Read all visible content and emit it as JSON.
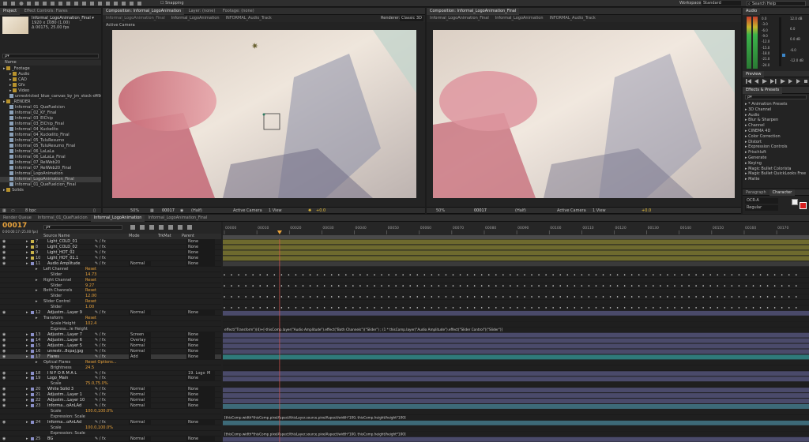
{
  "top": {
    "workspace_label": "Workspace:",
    "workspace_value": "Standard",
    "search_placeholder": "Search Help",
    "snapping": "Snapping"
  },
  "project": {
    "tab": "Project",
    "effect_controls_tab": "Effect Controls: Flares",
    "comp_name": "Informal_LogoAnimation_Final ▾",
    "comp_info1": "1920 x 1080 (1.00)",
    "comp_info2": "Δ 00175, 25.00 fps",
    "search_placeholder": "ρ▾",
    "name_header": "Name",
    "bpc": "8 bpc",
    "items": [
      {
        "label": "_Footage",
        "kind": "folder",
        "indent": 0
      },
      {
        "label": "Audio",
        "kind": "folder",
        "indent": 1
      },
      {
        "label": "CAD",
        "kind": "folder",
        "indent": 1
      },
      {
        "label": "Gfx",
        "kind": "folder",
        "indent": 1
      },
      {
        "label": "Video",
        "kind": "folder",
        "indent": 1
      },
      {
        "label": "unrestricted_blue_canvas_by_jm_stock-d49eg",
        "kind": "file",
        "indent": 1
      },
      {
        "label": "_RENDER",
        "kind": "folder",
        "indent": 0
      },
      {
        "label": "Informal_01_QueFuelcion",
        "kind": "file",
        "indent": 1
      },
      {
        "label": "Informal_02_KY_Final",
        "kind": "file",
        "indent": 1
      },
      {
        "label": "Informal_03_ElChip",
        "kind": "file",
        "indent": 1
      },
      {
        "label": "Informal_03_ElChip_Final",
        "kind": "file",
        "indent": 1
      },
      {
        "label": "Informal_04_Kuckelito",
        "kind": "file",
        "indent": 1
      },
      {
        "label": "Informal_04_Kuckelito_Final",
        "kind": "file",
        "indent": 1
      },
      {
        "label": "Informal_05_TuluResumo",
        "kind": "file",
        "indent": 1
      },
      {
        "label": "Informal_05_TuluResumo_Final",
        "kind": "file",
        "indent": 1
      },
      {
        "label": "Informal_06_LaLaLa",
        "kind": "file",
        "indent": 1
      },
      {
        "label": "Informal_06_LaLaLa_Final",
        "kind": "file",
        "indent": 1
      },
      {
        "label": "Informal_07_RelWeb20",
        "kind": "file",
        "indent": 1
      },
      {
        "label": "Informal_07_RelWeb20_Final",
        "kind": "file",
        "indent": 1
      },
      {
        "label": "Informal_LogoAnimation",
        "kind": "file",
        "indent": 1
      },
      {
        "label": "Informal_LogoAnimation_Final",
        "kind": "file",
        "indent": 1,
        "selected": true
      },
      {
        "label": "Informal_01_QueFuelcion_Final",
        "kind": "file",
        "indent": 1
      },
      {
        "label": "Solids",
        "kind": "folder",
        "indent": 0
      }
    ]
  },
  "comp1": {
    "tab": "Composition: Informal_LogoAnimation",
    "layer_tab": "Layer: (none)",
    "footage_tab": "Footage: (none)",
    "crumbs": [
      "Informal_LogoAnimation_Final",
      "Informal_LogoAnimation",
      "INFORMAL_Audio_Track"
    ],
    "renderer": "Renderer:",
    "renderer_value": "Classic 3D",
    "active_camera": "Active Camera",
    "zoom": "50%",
    "timecode": "00017",
    "res": "(Half)",
    "view": "Active Camera",
    "views": "1 View",
    "offset": "+0.0"
  },
  "comp2": {
    "tab": "Composition: Informal_LogoAnimation_Final",
    "crumbs": [
      "Informal_LogoAnimation_Final",
      "Informal_LogoAnimation",
      "INFORMAL_Audio_Track"
    ],
    "zoom": "50%",
    "timecode": "00017",
    "res": "(Half)",
    "view": "Active Camera",
    "views": "1 View",
    "offset": "+0.0"
  },
  "audio": {
    "tab": "Audio",
    "db_left": [
      "0.0",
      "-3.0",
      "-6.0",
      "-9.0",
      "-12.0",
      "-15.0",
      "-18.0",
      "-21.0",
      "-24.0"
    ],
    "db_right": [
      "12.0 dB",
      "6.0",
      "0.0 dB",
      "-6.0",
      "-12.0 dB"
    ]
  },
  "preview": {
    "tab": "Preview"
  },
  "effects": {
    "tab": "Effects & Presets",
    "search": "ρ▾",
    "items": [
      "* Animation Presets",
      "3D Channel",
      "Audio",
      "Blur & Sharpen",
      "Channel",
      "CINEMA 4D",
      "Color Correction",
      "Distort",
      "Expression Controls",
      "Frischluft",
      "Generate",
      "Keying",
      "Magic Bullet Colorista",
      "Magic Bullet QuickLooks Free",
      "Matte"
    ]
  },
  "character": {
    "tab1": "Paragraph",
    "tab2": "Character",
    "font": "OCR-A",
    "style": "Regular"
  },
  "timeline": {
    "tabs": [
      "Render Queue",
      "Informal_01_QueFuelcion",
      "Informal_LogoAnimation",
      "Informal_LogoAnimation_Final"
    ],
    "timecode": "00017",
    "timecode_sub": "0:00:00:17 (25.00 fps)",
    "search": "ρ▾",
    "cols": {
      "source": "Source Name",
      "mode": "Mode",
      "trkmat": "TrkMat",
      "parent": "Parent"
    },
    "ruler": [
      "00000",
      "00010",
      "00020",
      "00030",
      "00040",
      "00050",
      "00060",
      "00070",
      "00080",
      "00090",
      "00100",
      "00110",
      "00120",
      "00130",
      "00140",
      "00150",
      "00160",
      "00170"
    ],
    "expr1": "effect(\"Transform\")(4)+[-thisComp.layer(\"Audio Amplitude\").effect(\"Both Channels\")(\"Slider\") ; (1 * thisComp.layer(\"Audio Amplitude\").effect(\"Slider Control\")(\"Slider\")]",
    "expr2": "[thisComp.width*thisComp.pixelAspect/thisLayer.source.pixelAspect/width*100, thisComp.height/height*100]",
    "expr3": "[thisComp.width*thisComp.pixelAspect/thisLayer.source.pixelAspect/width*100, thisComp.height/height*100]",
    "rows": [
      {
        "num": "7",
        "name": "Light_COLD_01",
        "mode": "",
        "parent": "None",
        "lv": 0
      },
      {
        "num": "8",
        "name": "Light_COLD_02",
        "mode": "",
        "parent": "None",
        "lv": 0
      },
      {
        "num": "9",
        "name": "Light_HOT_02",
        "mode": "",
        "parent": "None",
        "lv": 0
      },
      {
        "num": "10",
        "name": "Light_HOT_01.1",
        "mode": "",
        "parent": "None",
        "lv": 0
      },
      {
        "num": "11",
        "name": "Audio Amplitude",
        "mode": "Normal",
        "parent": "None",
        "lv": 0
      },
      {
        "num": "",
        "name": "Left Channel",
        "val": "Reset",
        "lv": 1
      },
      {
        "num": "",
        "name": "Slider",
        "val": "14.73",
        "lv": 2
      },
      {
        "num": "",
        "name": "Right Channel",
        "val": "Reset",
        "lv": 1
      },
      {
        "num": "",
        "name": "Slider",
        "val": "9.27",
        "lv": 2
      },
      {
        "num": "",
        "name": "Both Channels",
        "val": "Reset",
        "lv": 1
      },
      {
        "num": "",
        "name": "Slider",
        "val": "12.00",
        "lv": 2
      },
      {
        "num": "",
        "name": "Slider Control",
        "val": "Reset",
        "lv": 1
      },
      {
        "num": "",
        "name": "Slider",
        "val": "1.00",
        "lv": 2
      },
      {
        "num": "12",
        "name": "Adjustm...Layer 9",
        "mode": "Normal",
        "parent": "None",
        "lv": 0
      },
      {
        "num": "",
        "name": "Transform",
        "val": "Reset",
        "lv": 1
      },
      {
        "num": "",
        "name": "Scale Height",
        "val": "102.4",
        "lv": 2
      },
      {
        "num": "",
        "name": "Express...le Height",
        "val": "",
        "lv": 2
      },
      {
        "num": "13",
        "name": "Adjustm...Layer 7",
        "mode": "Screen",
        "parent": "None",
        "lv": 0
      },
      {
        "num": "14",
        "name": "Adjustm...Layer 6",
        "mode": "Overlay",
        "parent": "None",
        "lv": 0
      },
      {
        "num": "15",
        "name": "Adjustm...Layer 5",
        "mode": "Normal",
        "parent": "None",
        "lv": 0
      },
      {
        "num": "16",
        "name": "unrestr...8cpaj.jpg",
        "mode": "Normal",
        "parent": "None",
        "lv": 0
      },
      {
        "num": "17",
        "name": "Flares",
        "mode": "Add",
        "parent": "None",
        "lv": 0,
        "sel": true
      },
      {
        "num": "",
        "name": "Optical Flares",
        "val": "Reset  Options...",
        "lv": 1
      },
      {
        "num": "",
        "name": "Brightness",
        "val": "24.5",
        "lv": 2
      },
      {
        "num": "18",
        "name": "I N F O R M A L",
        "mode": "",
        "parent": "19. Logo_M",
        "lv": 0
      },
      {
        "num": "19",
        "name": "Logo_Main",
        "mode": "",
        "parent": "None",
        "lv": 0
      },
      {
        "num": "",
        "name": "Scale",
        "val": "75.0,75.0%",
        "lv": 2
      },
      {
        "num": "20",
        "name": "White Solid 3",
        "mode": "Normal",
        "parent": "None",
        "lv": 0
      },
      {
        "num": "21",
        "name": "Adjustm...Layer 1",
        "mode": "Normal",
        "parent": "None",
        "lv": 0
      },
      {
        "num": "22",
        "name": "Adjustm...Layer 10",
        "mode": "Normal",
        "parent": "None",
        "lv": 0
      },
      {
        "num": "23",
        "name": "Informa...oAnLAd",
        "mode": "Normal",
        "parent": "None",
        "lv": 0
      },
      {
        "num": "",
        "name": "Scale",
        "val": "100.0,100.0%",
        "lv": 2
      },
      {
        "num": "",
        "name": "Expression: Scale",
        "val": "",
        "lv": 2
      },
      {
        "num": "24",
        "name": "Informa...oAnLAd",
        "mode": "Normal",
        "parent": "None",
        "lv": 0
      },
      {
        "num": "",
        "name": "Scale",
        "val": "100.0,100.0%",
        "lv": 2
      },
      {
        "num": "",
        "name": "Expression: Scale",
        "val": "",
        "lv": 2
      },
      {
        "num": "25",
        "name": "BG",
        "mode": "Normal",
        "parent": "None",
        "lv": 0
      }
    ]
  }
}
